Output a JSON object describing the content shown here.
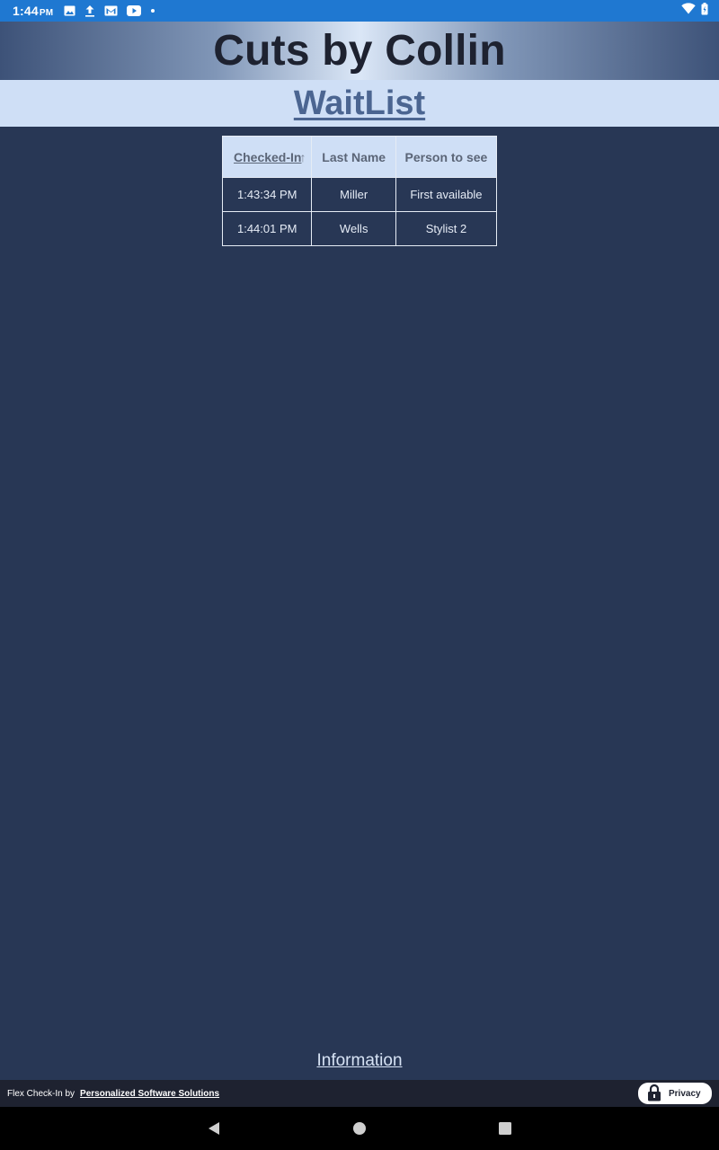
{
  "status_bar": {
    "time": "1:44",
    "ampm": "PM",
    "icons": [
      "image-icon",
      "upload-icon",
      "gmail-icon",
      "youtube-icon",
      "dot-icon",
      "wifi-icon",
      "battery-icon"
    ]
  },
  "header": {
    "title": "Cuts by Collin",
    "subtitle_link": "WaitList"
  },
  "table": {
    "columns": [
      {
        "label": "Checked-In",
        "sorted": true,
        "sort_direction": "ascending"
      },
      {
        "label": "Last Name",
        "sorted": false
      },
      {
        "label": "Person to see",
        "sorted": false
      }
    ],
    "rows": [
      {
        "checked_in": "1:43:34 PM",
        "last_name": "Miller",
        "person_to_see": "First available"
      },
      {
        "checked_in": "1:44:01 PM",
        "last_name": "Wells",
        "person_to_see": "Stylist 2"
      }
    ]
  },
  "info_link": "Information",
  "footer": {
    "by_text": "Flex Check-In by",
    "company_link": "Personalized Software Solutions",
    "privacy_label": "Privacy"
  },
  "nav": {
    "back": "back-icon",
    "home": "home-icon",
    "recents": "recents-icon"
  },
  "colors": {
    "background": "#283755",
    "status_bar": "#1f78d1",
    "header_light": "#cfdff6",
    "link": "#4b6591",
    "footer": "#1e2230"
  }
}
